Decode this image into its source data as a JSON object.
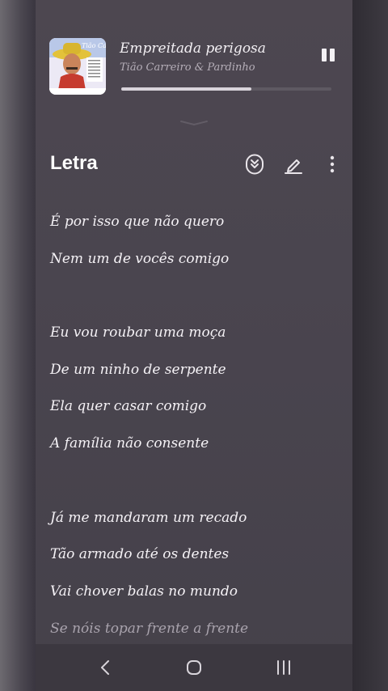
{
  "now_playing": {
    "title": "Empreitada perigosa",
    "artist": "Tião Carreiro & Pardinho",
    "progress": 0.62,
    "album_art_text": "Tião Carreiro"
  },
  "lyrics_section": {
    "title": "Letra",
    "icons": [
      "auto-scroll-icon",
      "edit-icon",
      "more-icon"
    ]
  },
  "lyrics": [
    "É por isso que não quero",
    "Nem um de vocês comigo",
    "",
    "Eu vou roubar uma moça",
    "De um ninho de serpente",
    "Ela quer casar comigo",
    "A família não consente",
    "",
    "Já me mandaram um recado",
    "Tão armado até os dentes",
    "Vai chover balas no mundo",
    "Se nóis topar frente a frente"
  ],
  "navigation": {
    "icons": [
      "back-icon",
      "home-icon",
      "recents-icon"
    ]
  },
  "colors": {
    "panel": "#4a454f",
    "text": "#f5f2f6",
    "muted": "#b5aeb8",
    "nav_bar": "#3c3840"
  }
}
